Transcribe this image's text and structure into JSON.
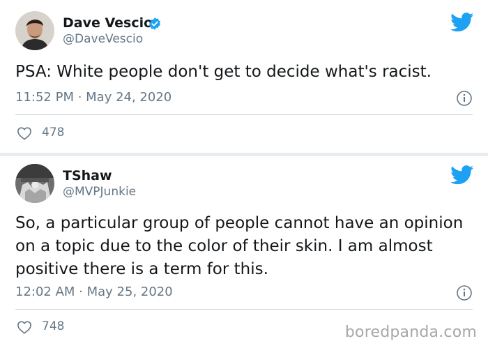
{
  "tweets": [
    {
      "name": "Dave Vescio",
      "handle": "@DaveVescio",
      "verified": true,
      "text": "PSA: White people don't get to decide what's racist.",
      "timestamp": "11:52 PM · May 24, 2020",
      "likes": "478"
    },
    {
      "name": "TShaw",
      "handle": "@MVPJunkie",
      "verified": false,
      "text": "So, a particular group of people cannot have an opinion on a topic due to the color of their skin. I am almost positive there is a term for this.",
      "timestamp": "12:02 AM · May 25, 2020",
      "likes": "748"
    }
  ],
  "watermark": "boredpanda.com",
  "colors": {
    "twitter_blue": "#1da1f2",
    "secondary_text": "#657786",
    "divider": "#ccd6dd"
  },
  "icons": [
    "twitter-bird-icon",
    "verified-badge-icon",
    "info-icon",
    "heart-icon"
  ]
}
